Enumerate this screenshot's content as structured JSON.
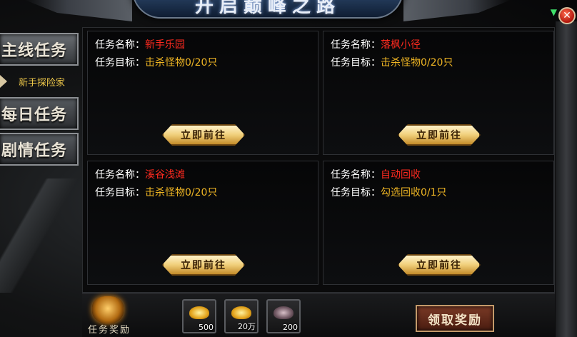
{
  "banner": {
    "title": "开启巅峰之路"
  },
  "close_label": "✕",
  "tabs": [
    {
      "label": "主线任务"
    },
    {
      "label": "每日任务"
    },
    {
      "label": "剧情任务"
    }
  ],
  "sub_item": {
    "label": "新手探险家"
  },
  "quests": [
    {
      "name_label": "任务名称：",
      "name": "新手乐园",
      "goal_label": "任务目标：",
      "goal": "击杀怪物0/20只",
      "button": "立即前往"
    },
    {
      "name_label": "任务名称：",
      "name": "落枫小径",
      "goal_label": "任务目标：",
      "goal": "击杀怪物0/20只",
      "button": "立即前往"
    },
    {
      "name_label": "任务名称：",
      "name": "溪谷浅滩",
      "goal_label": "任务目标：",
      "goal": "击杀怪物0/20只",
      "button": "立即前往"
    },
    {
      "name_label": "任务名称：",
      "name": "自动回收",
      "goal_label": "任务目标：",
      "goal": "勾选回收0/1只",
      "button": "立即前往"
    }
  ],
  "reward": {
    "title": "任务奖励",
    "items": [
      {
        "icon": "gold-ingot-icon",
        "count": "500"
      },
      {
        "icon": "gold-pile-icon",
        "count": "20万"
      },
      {
        "icon": "crystal-icon",
        "count": "200"
      }
    ],
    "claim_label": "领取奖励"
  },
  "colors": {
    "quest_name": "#ff2a1f",
    "quest_goal": "#f0b624",
    "sub_item": "#f0c94a"
  }
}
